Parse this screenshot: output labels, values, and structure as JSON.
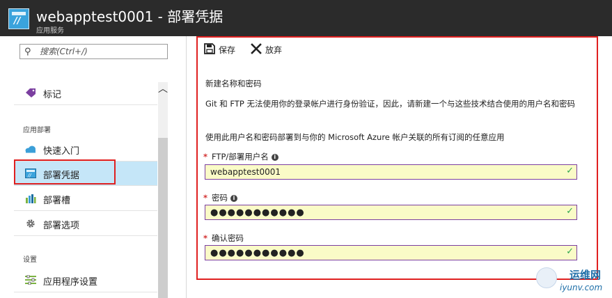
{
  "header": {
    "title": "webapptest0001 - 部署凭据",
    "subtitle": "应用服务",
    "icon": "app-service-icon"
  },
  "sidebar": {
    "search": {
      "placeholder": "搜索(Ctrl+/)",
      "value": ""
    },
    "items": [
      {
        "label": "标记",
        "icon": "tag-icon"
      },
      {
        "label": "快速入门",
        "icon": "cloud-icon"
      },
      {
        "label": "部署凭据",
        "icon": "app-service-icon",
        "selected": true
      },
      {
        "label": "部署槽",
        "icon": "slots-icon"
      },
      {
        "label": "部署选项",
        "icon": "gear-icon"
      },
      {
        "label": "应用程序设置",
        "icon": "settings-list-icon"
      }
    ],
    "sections": {
      "deployment": "应用部署",
      "settings": "设置"
    }
  },
  "toolbar": {
    "save_label": "保存",
    "discard_label": "放弃"
  },
  "form": {
    "heading": "新建名称和密码",
    "description": "Git 和 FTP 无法使用你的登录帐户进行身份验证，因此，请新建一个与这些技术结合使用的用户名和密码",
    "description2": "使用此用户名和密码部署到与你的 Microsoft Azure 帐户关联的所有订阅的任意应用",
    "required_mark": "*",
    "username_label": "FTP/部署用户名",
    "username_value": "webapptest0001",
    "password_label": "密码",
    "password_value": "●●●●●●●●●●●",
    "confirm_label": "确认密码",
    "confirm_value": "●●●●●●●●●●●"
  },
  "watermark": {
    "text1": "运维网",
    "text2": "iyunv.com"
  },
  "colors": {
    "header_bg": "#2b2b2b",
    "selected_bg": "#c5e6f8",
    "highlight_border": "#e02020",
    "field_bg": "#fafbc7",
    "field_border": "#7b3fa0",
    "valid_check": "#2fa84f",
    "required": "#d32f2f"
  }
}
